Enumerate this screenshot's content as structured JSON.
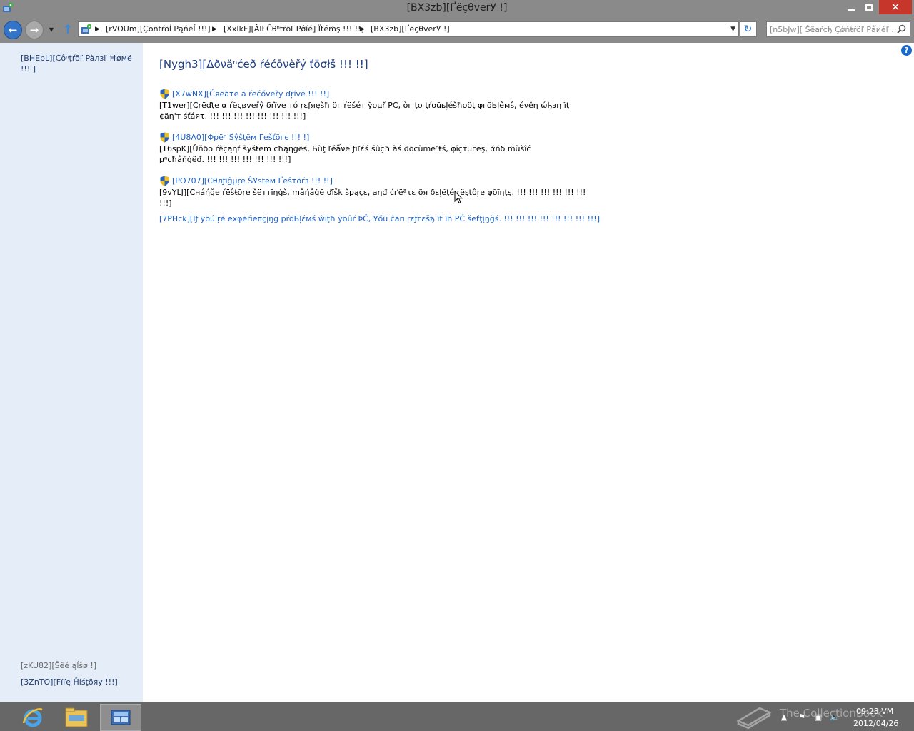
{
  "window": {
    "title": "[BX3zb][ҐëçθvеrУ !]"
  },
  "address": {
    "segments": [
      "[rVOUm][Çoñtŕöĺ Pąńëĺ !!!]",
      "[XxIkF][Ȧlł Ĉθⁿŧŕöľ Рǿíé] Ïŧéṁş !!! !!]",
      "[BX3zb][ҐëçθvеrУ !]"
    ]
  },
  "search": {
    "placeholder": "[n5bJw][ Ŝëаŕсђ Çǿńŧŕöľ Рǻиéľ ..."
  },
  "sidebar": {
    "home_link": "[BHEbL][Ćôⁿţŕõľ Pàлзľ Ħøмё !!! ]",
    "see_also": "[zKU82][Ŝêé ąĺšø !]",
    "file_history": "[3ZnTO][Fïľę Ĥíśţöяу !!!]"
  },
  "main": {
    "title": "[Nygh3][Δðνäⁿćеð ŕéćōνèřý ťöσłš !!! !!]",
    "tools": [
      {
        "label": "[X7wNX][Ćяëàτе ă ŕеćővеřу ďŗívё !!! !!]",
        "description": "[T1wer][Çŗёďţе α ŕёçøvеřŷ δŕïvе тό ŗεƒяęšħ öг ŕёšéт ўоμř PC, òг ţσ ţŕоūьļéšħоöţ φгõЬļêмŝ, éνêη ώђэη ïţ ¢äη'т śťáяτ. !!! !!! !!! !!! !!! !!! !!! !!!]"
      },
      {
        "label": "[4U8A0][Φрёⁿ Ŝŷŝţём Γеšťõгє !!! !]",
        "description": "[T6spK][Ůňðō ŕêçąηť šуšŧēm cħąηġëś, Бùţ ľéǻνё ƒïľέš śûçħ àś đõсùmеⁿŧś, φîçтµгеş, άńδ ṁùšîć µⁿсħåήġëđ. !!! !!! !!! !!! !!! !!! !!!]"
      },
      {
        "label": "[PO707][Сθлƒïĝμŗе ŜУѕtем Ґеŝτõŕз !!! !!]",
        "description": "[9vYLJ][Cнáήğе ŕёŝŧōŗė šёттīŋġš, måήåġē ďīšk šрąçε, аηđ ćґёªτε öя ðεļёţé ŗёşţôŗę φõīηţş. !!! !!! !!! !!! !!! !!! !!!]"
      }
    ],
    "refresh_link": "[7PHck][Ιƒ ÿõú'ŗė ехφėŕіеπçįŋġ рŕõБļέмś ŵīţħ ўõûŕ ÞĈ, Уőü ĉãп ŗεƒгεšђ ït ïñ РĆ šеťţįŋğś. !!! !!! !!! !!! !!! !!! !!! !!!]"
  },
  "taskbar": {
    "time": "09:23 VM",
    "date": "2012/04/26"
  },
  "watermark": {
    "text": "The CollectionBook"
  },
  "icons": {
    "window": "control-panel-icon",
    "back": "back-arrow-icon",
    "forward": "forward-arrow-icon",
    "up": "up-arrow-icon",
    "refresh": "refresh-icon",
    "search": "magnifier-icon",
    "help": "help-icon",
    "shield": "uac-shield-icon"
  },
  "colors": {
    "accent": "#1d60c9",
    "title_blue": "#1d3e84",
    "sidebar_bg": "#e4edf8",
    "chrome": "#8a8a8a",
    "taskbar": "#676767",
    "close_red": "#c7362b"
  }
}
